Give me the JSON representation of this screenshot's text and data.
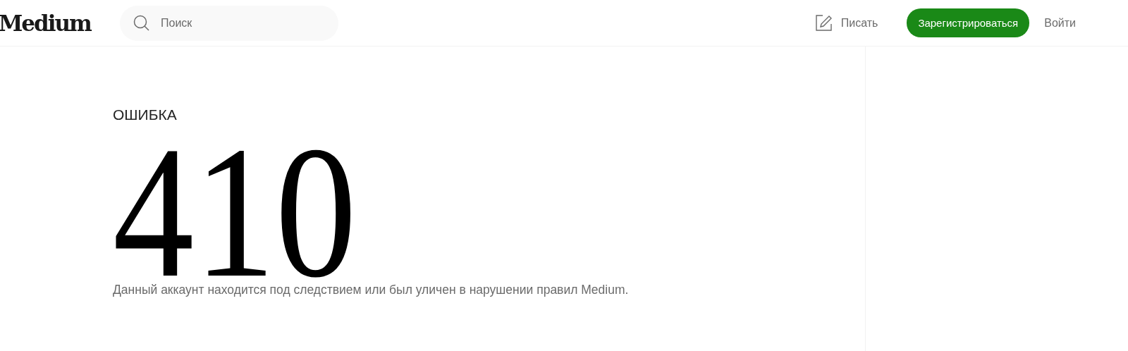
{
  "header": {
    "logo": "Medium",
    "search": {
      "placeholder": "Поиск"
    },
    "write": "Писать",
    "signup": "Зарегистрироваться",
    "signin": "Войти"
  },
  "error": {
    "label": "ОШИБКА",
    "code": "410",
    "message": "Данный аккаунт находится под следствием или был уличен в нарушении правил Medium."
  }
}
